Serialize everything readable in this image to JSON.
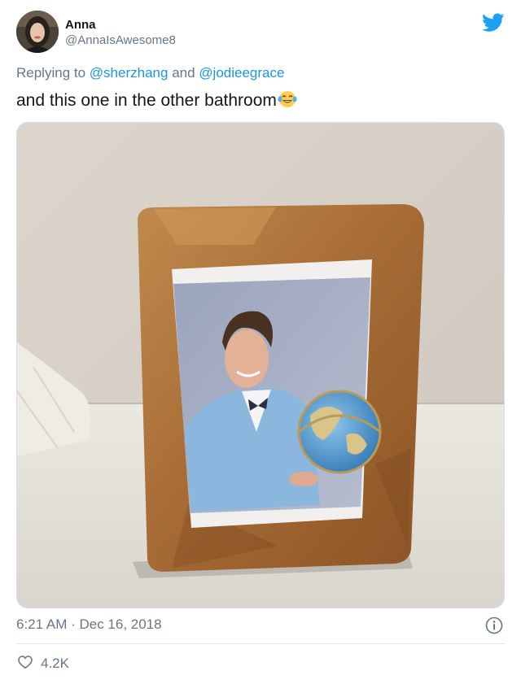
{
  "author": {
    "name": "Anna",
    "handle": "@AnnaIsAwesome8",
    "avatar_icon": "user-avatar-photo"
  },
  "brand": {
    "icon": "twitter-bird-icon",
    "color": "#1da1f2"
  },
  "reply": {
    "prefix": "Replying to",
    "mention_1": "@sherzhang",
    "conjunction": "and",
    "mention_2": "@jodieegrace"
  },
  "tweet": {
    "text": "and this one in the other bathroom",
    "emoji": "face-with-tears-of-joy"
  },
  "media": {
    "kind": "photo",
    "subject": "wooden-picture-frame-with-portrait"
  },
  "meta": {
    "timestamp": "6:21 AM · Dec 16, 2018",
    "info_icon": "info-icon"
  },
  "stats": {
    "like_icon": "heart-icon",
    "likes": "4.2K"
  },
  "colors": {
    "text": "#14171a",
    "secondary": "#657786",
    "link": "#1b95e0",
    "divider": "#e1e8ed"
  }
}
